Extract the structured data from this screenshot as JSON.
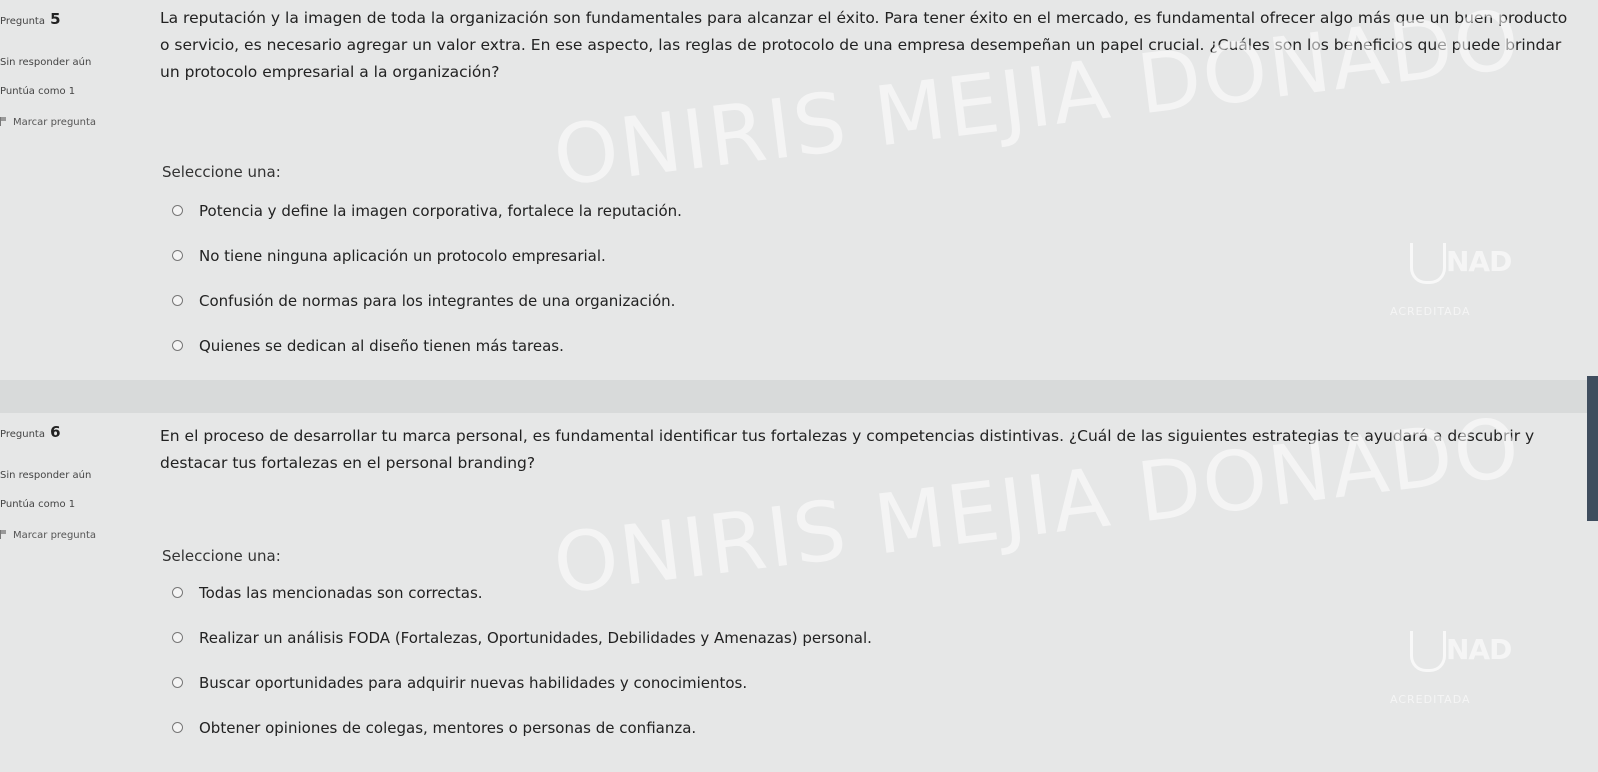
{
  "questions": [
    {
      "number_label": "Pregunta",
      "number": "5",
      "state": "Sin responder aún",
      "grade": "Puntúa como 1",
      "flag_label": "Marcar pregunta",
      "text": "La reputación y la imagen de toda la organización son fundamentales para alcanzar el éxito. Para tener éxito en el mercado, es fundamental ofrecer algo más que un buen producto o servicio, es necesario agregar un valor extra. En ese aspecto, las reglas de protocolo de una empresa desempeñan un papel crucial. ¿Cuáles son los beneficios que puede brindar un protocolo empresarial a la organización?",
      "prompt": "Seleccione una:",
      "answers": [
        "Potencia y define la imagen corporativa, fortalece la reputación.",
        "No tiene ninguna aplicación un protocolo empresarial.",
        "Confusión de normas para los integrantes de una organización.",
        "Quienes se dedican al diseño tienen más tareas."
      ]
    },
    {
      "number_label": "Pregunta",
      "number": "6",
      "state": "Sin responder aún",
      "grade": "Puntúa como 1",
      "flag_label": "Marcar pregunta",
      "text": "En el proceso de desarrollar tu marca personal, es fundamental identificar tus fortalezas y competencias distintivas. ¿Cuál de las siguientes estrategias te ayudará a descubrir y destacar tus fortalezas en el personal branding?",
      "prompt": "Seleccione una:",
      "answers": [
        "Todas las mencionadas son correctas.",
        "Realizar un análisis FODA (Fortalezas, Oportunidades, Debilidades y Amenazas) personal.",
        "Buscar oportunidades para adquirir nuevas habilidades y conocimientos.",
        "Obtener opiniones de colegas, mentores o personas de confianza."
      ]
    }
  ],
  "watermark": {
    "text": "ONIRIS MEJIA DONADO",
    "logo_letter": "U",
    "logo_text": "NAD",
    "logo_sub": "ACREDITADA"
  },
  "colors": {
    "background": "#e6e7e7",
    "separator": "#d8dada",
    "scrollbar": "#3f4d5e"
  }
}
